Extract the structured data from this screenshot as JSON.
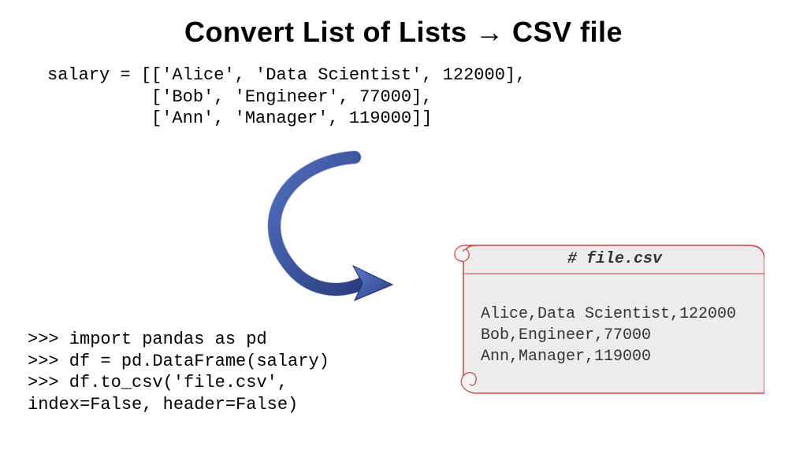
{
  "title": "Convert List of Lists → CSV file",
  "source_code": "salary = [['Alice', 'Data Scientist', 122000],\n          ['Bob', 'Engineer', 77000],\n          ['Ann', 'Manager', 119000]]",
  "repl_code": ">>> import pandas as pd\n>>> df = pd.DataFrame(salary)\n>>> df.to_csv('file.csv',\nindex=False, header=False)",
  "file_label": "# file.csv",
  "file_content": "Alice,Data Scientist,122000\nBob,Engineer,77000\nAnn,Manager,119000",
  "colors": {
    "arrow_fill": "#3b5aa8",
    "arrow_stroke": "#1f2f63",
    "scroll_fill": "#ececec",
    "scroll_stroke": "#d2403f"
  }
}
